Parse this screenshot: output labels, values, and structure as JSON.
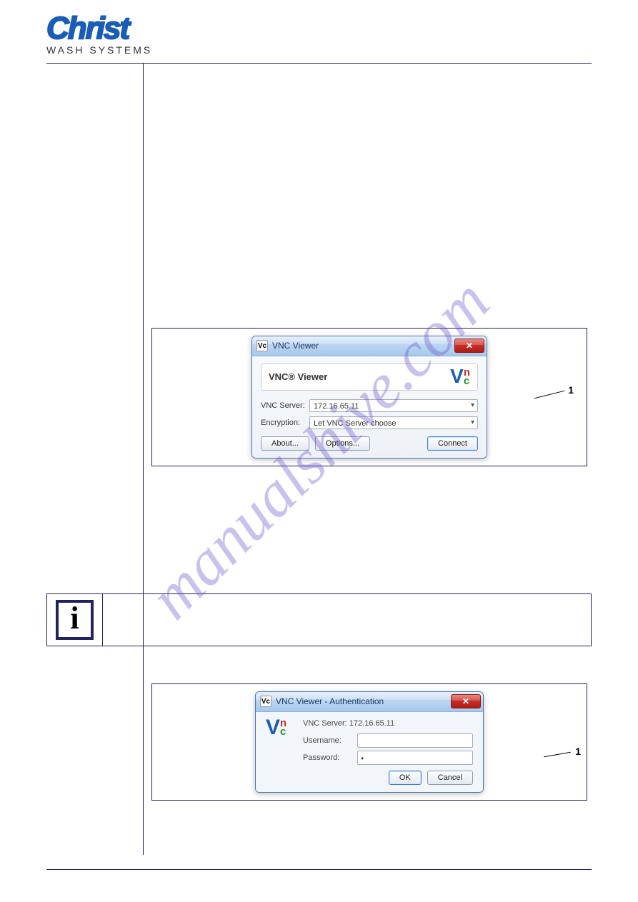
{
  "brand": {
    "name": "Christ",
    "tagline": "WASH SYSTEMS"
  },
  "watermark": "manualshive.com",
  "dialog1": {
    "window_title": "VNC Viewer",
    "heading": "VNC® Viewer",
    "server_label": "VNC Server:",
    "server_value": "172.16.65.11",
    "encryption_label": "Encryption:",
    "encryption_value": "Let VNC Server choose",
    "about": "About...",
    "options": "Options...",
    "connect": "Connect",
    "callout": "1"
  },
  "info_icon": "i",
  "dialog2": {
    "window_title": "VNC Viewer - Authentication",
    "server_label": "VNC Server: 172.16.65.11",
    "username_label": "Username:",
    "username_value": "",
    "password_label": "Password:",
    "password_value": "•",
    "ok": "OK",
    "cancel": "Cancel",
    "callout": "1"
  },
  "icons": {
    "vnc_small": "Vc",
    "close": "✕"
  }
}
